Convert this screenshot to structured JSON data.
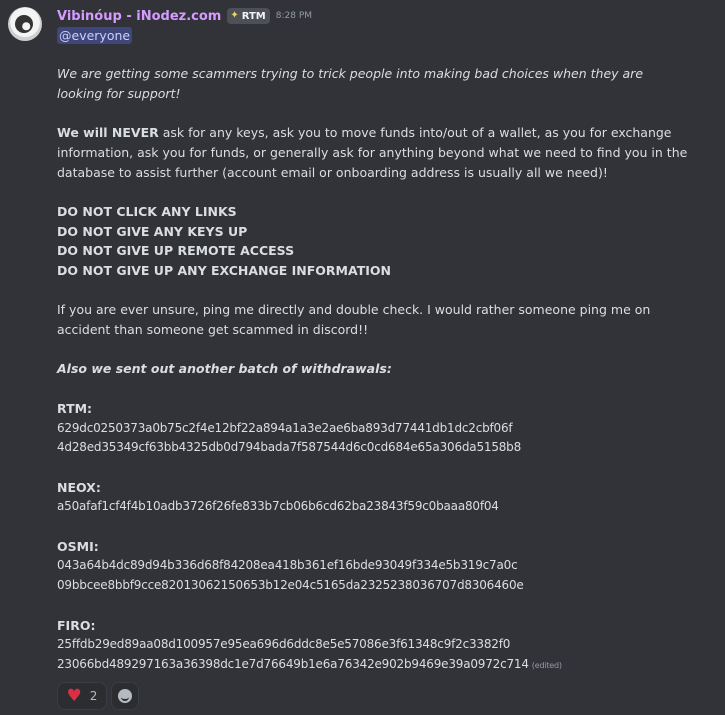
{
  "message": {
    "author": "Vibinóup - iNodez.com",
    "role_badge": "RTM",
    "role_icon": "sparkle-icon",
    "timestamp": "8:28 PM",
    "mention": "@everyone",
    "warning_italic": "We are getting some scammers trying to trick people into making bad choices when they are looking for support!",
    "never_prefix": "We will NEVER",
    "never_text": " ask for any keys, ask you to move funds into/out of a wallet, as you for exchange information, ask you for funds, or generally ask for anything beyond what we need to find you in the database to assist further (account email or onboarding address is usually all we need)!",
    "rules": [
      "DO NOT CLICK ANY LINKS",
      "DO NOT GIVE ANY KEYS UP",
      "DO NOT GIVE UP REMOTE ACCESS",
      "DO NOT GIVE UP ANY EXCHANGE INFORMATION"
    ],
    "unsure_text": "If you are ever unsure, ping me directly and double check.  I would rather someone ping me on accident than someone get scammed in discord!!",
    "withdrawals_heading": "Also we sent out another batch of withdrawals:",
    "withdrawals": [
      {
        "label": "RTM:",
        "hashes": [
          "629dc0250373a0b75c2f4e12bf22a894a1a3e2ae6ba893d77441db1dc2cbf06f",
          "4d28ed35349cf63bb4325db0d794bada7f587544d6c0cd684e65a306da5158b8"
        ]
      },
      {
        "label": "NEOX:",
        "hashes": [
          "a50afaf1cf4f4b10adb3726f26fe833b7cb06b6cd62ba23843f59c0baaa80f04"
        ]
      },
      {
        "label": "OSMI:",
        "hashes": [
          "043a64b4dc89d94b336d68f84208ea418b361ef16bde93049f334e5b319c7a0c",
          "09bbcee8bbf9cce82013062150653b12e04c5165da2325238036707d8306460e"
        ]
      },
      {
        "label": "FIRO:",
        "hashes": [
          "25ffdb29ed89aa08d100957e95ea696d6ddc8e5e57086e3f61348c9f2c3382f0",
          "23066bd489297163a36398dc1e7d76649b1e6a76342e902b9469e39a0972c714"
        ]
      }
    ],
    "edited_label": "(edited)",
    "reactions": [
      {
        "icon": "heart-icon",
        "count": "2"
      }
    ],
    "add_reaction_icon": "smile-icon"
  }
}
